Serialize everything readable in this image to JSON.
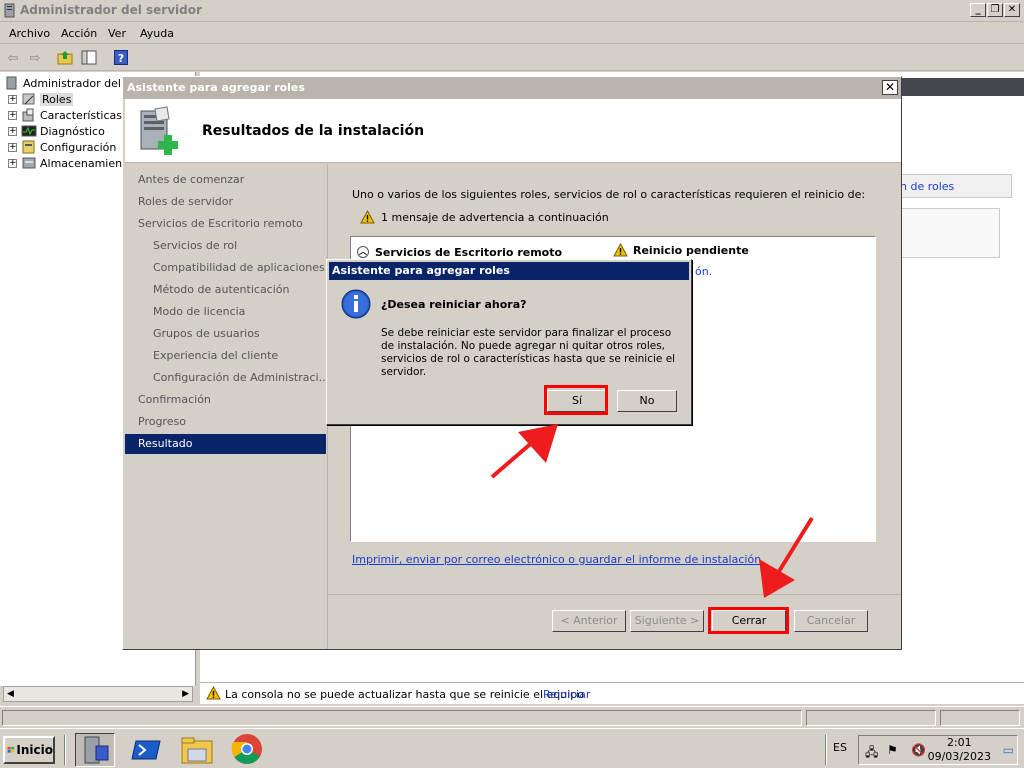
{
  "main_window": {
    "title": "Administrador del servidor",
    "menu": [
      "Archivo",
      "Acción",
      "Ver",
      "Ayuda"
    ]
  },
  "tree": {
    "root": "Administrador del se",
    "items": [
      "Roles",
      "Características",
      "Diagnóstico",
      "Configuración",
      "Almacenamiento"
    ]
  },
  "right_pane": {
    "link_fragment": "n de roles",
    "notification": "La consola no se puede actualizar hasta que se reinicie el equipo",
    "notification_link": "Reiniciar"
  },
  "wizard": {
    "title": "Asistente para agregar roles",
    "header": "Resultados de la instalación",
    "nav": [
      {
        "label": "Antes de comenzar",
        "sub": false
      },
      {
        "label": "Roles de servidor",
        "sub": false
      },
      {
        "label": "Servicios de Escritorio remoto",
        "sub": false
      },
      {
        "label": "Servicios de rol",
        "sub": true
      },
      {
        "label": "Compatibilidad de aplicaciones",
        "sub": true
      },
      {
        "label": "Método de autenticación",
        "sub": true
      },
      {
        "label": "Modo de licencia",
        "sub": true
      },
      {
        "label": "Grupos de usuarios",
        "sub": true
      },
      {
        "label": "Experiencia del cliente",
        "sub": true
      },
      {
        "label": "Configuración de Administraci...",
        "sub": true
      },
      {
        "label": "Confirmación",
        "sub": false
      },
      {
        "label": "Progreso",
        "sub": false
      },
      {
        "label": "Resultado",
        "sub": false,
        "active": true
      }
    ],
    "intro": "Uno o varios de los siguientes roles, servicios de rol o características requieren el reinicio de:",
    "warning": "1 mensaje de advertencia a continuación",
    "result_role": "Servicios de Escritorio remoto",
    "result_status": "Reinicio pendiente",
    "result_fragment": "ón.",
    "print_link": "Imprimir, enviar por correo electrónico o guardar el informe de instalación",
    "buttons": {
      "back": "< Anterior",
      "next": "Siguiente >",
      "close": "Cerrar",
      "cancel": "Cancelar"
    }
  },
  "dialog": {
    "title": "Asistente para agregar roles",
    "question": "¿Desea reiniciar ahora?",
    "message": "Se debe reiniciar este servidor para finalizar el proceso de instalación. No puede agregar ni quitar otros roles, servicios de rol o características hasta que se reinicie el servidor.",
    "yes": "Sí",
    "no": "No"
  },
  "taskbar": {
    "start": "Inicio",
    "lang": "ES",
    "time": "2:01",
    "date": "09/03/2023"
  },
  "colors": {
    "highlight": "#ff0000",
    "selection": "#0a246a",
    "link": "#1a3ccc"
  }
}
